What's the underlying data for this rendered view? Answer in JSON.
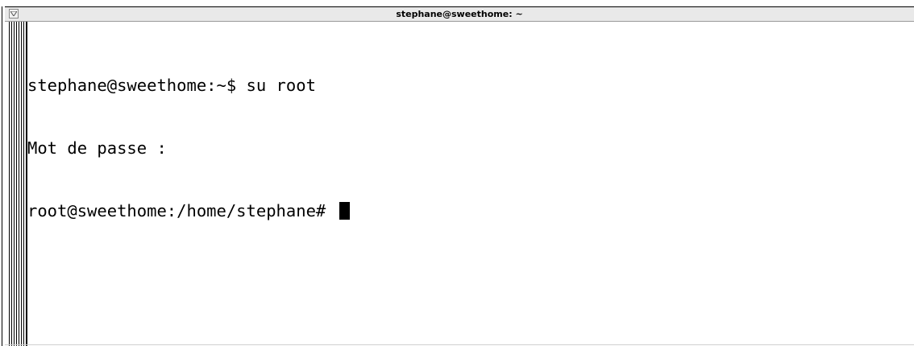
{
  "window": {
    "title": "stephane@sweethome: ~",
    "menu_icon": "triangle-down-icon"
  },
  "terminal": {
    "lines": [
      "stephane@sweethome:~$ su root",
      "Mot de passe :",
      "root@sweethome:/home/stephane# "
    ],
    "cursor": "block"
  },
  "colors": {
    "background": "#ffffff",
    "foreground": "#000000",
    "titlebar": "#e9e9e9"
  }
}
